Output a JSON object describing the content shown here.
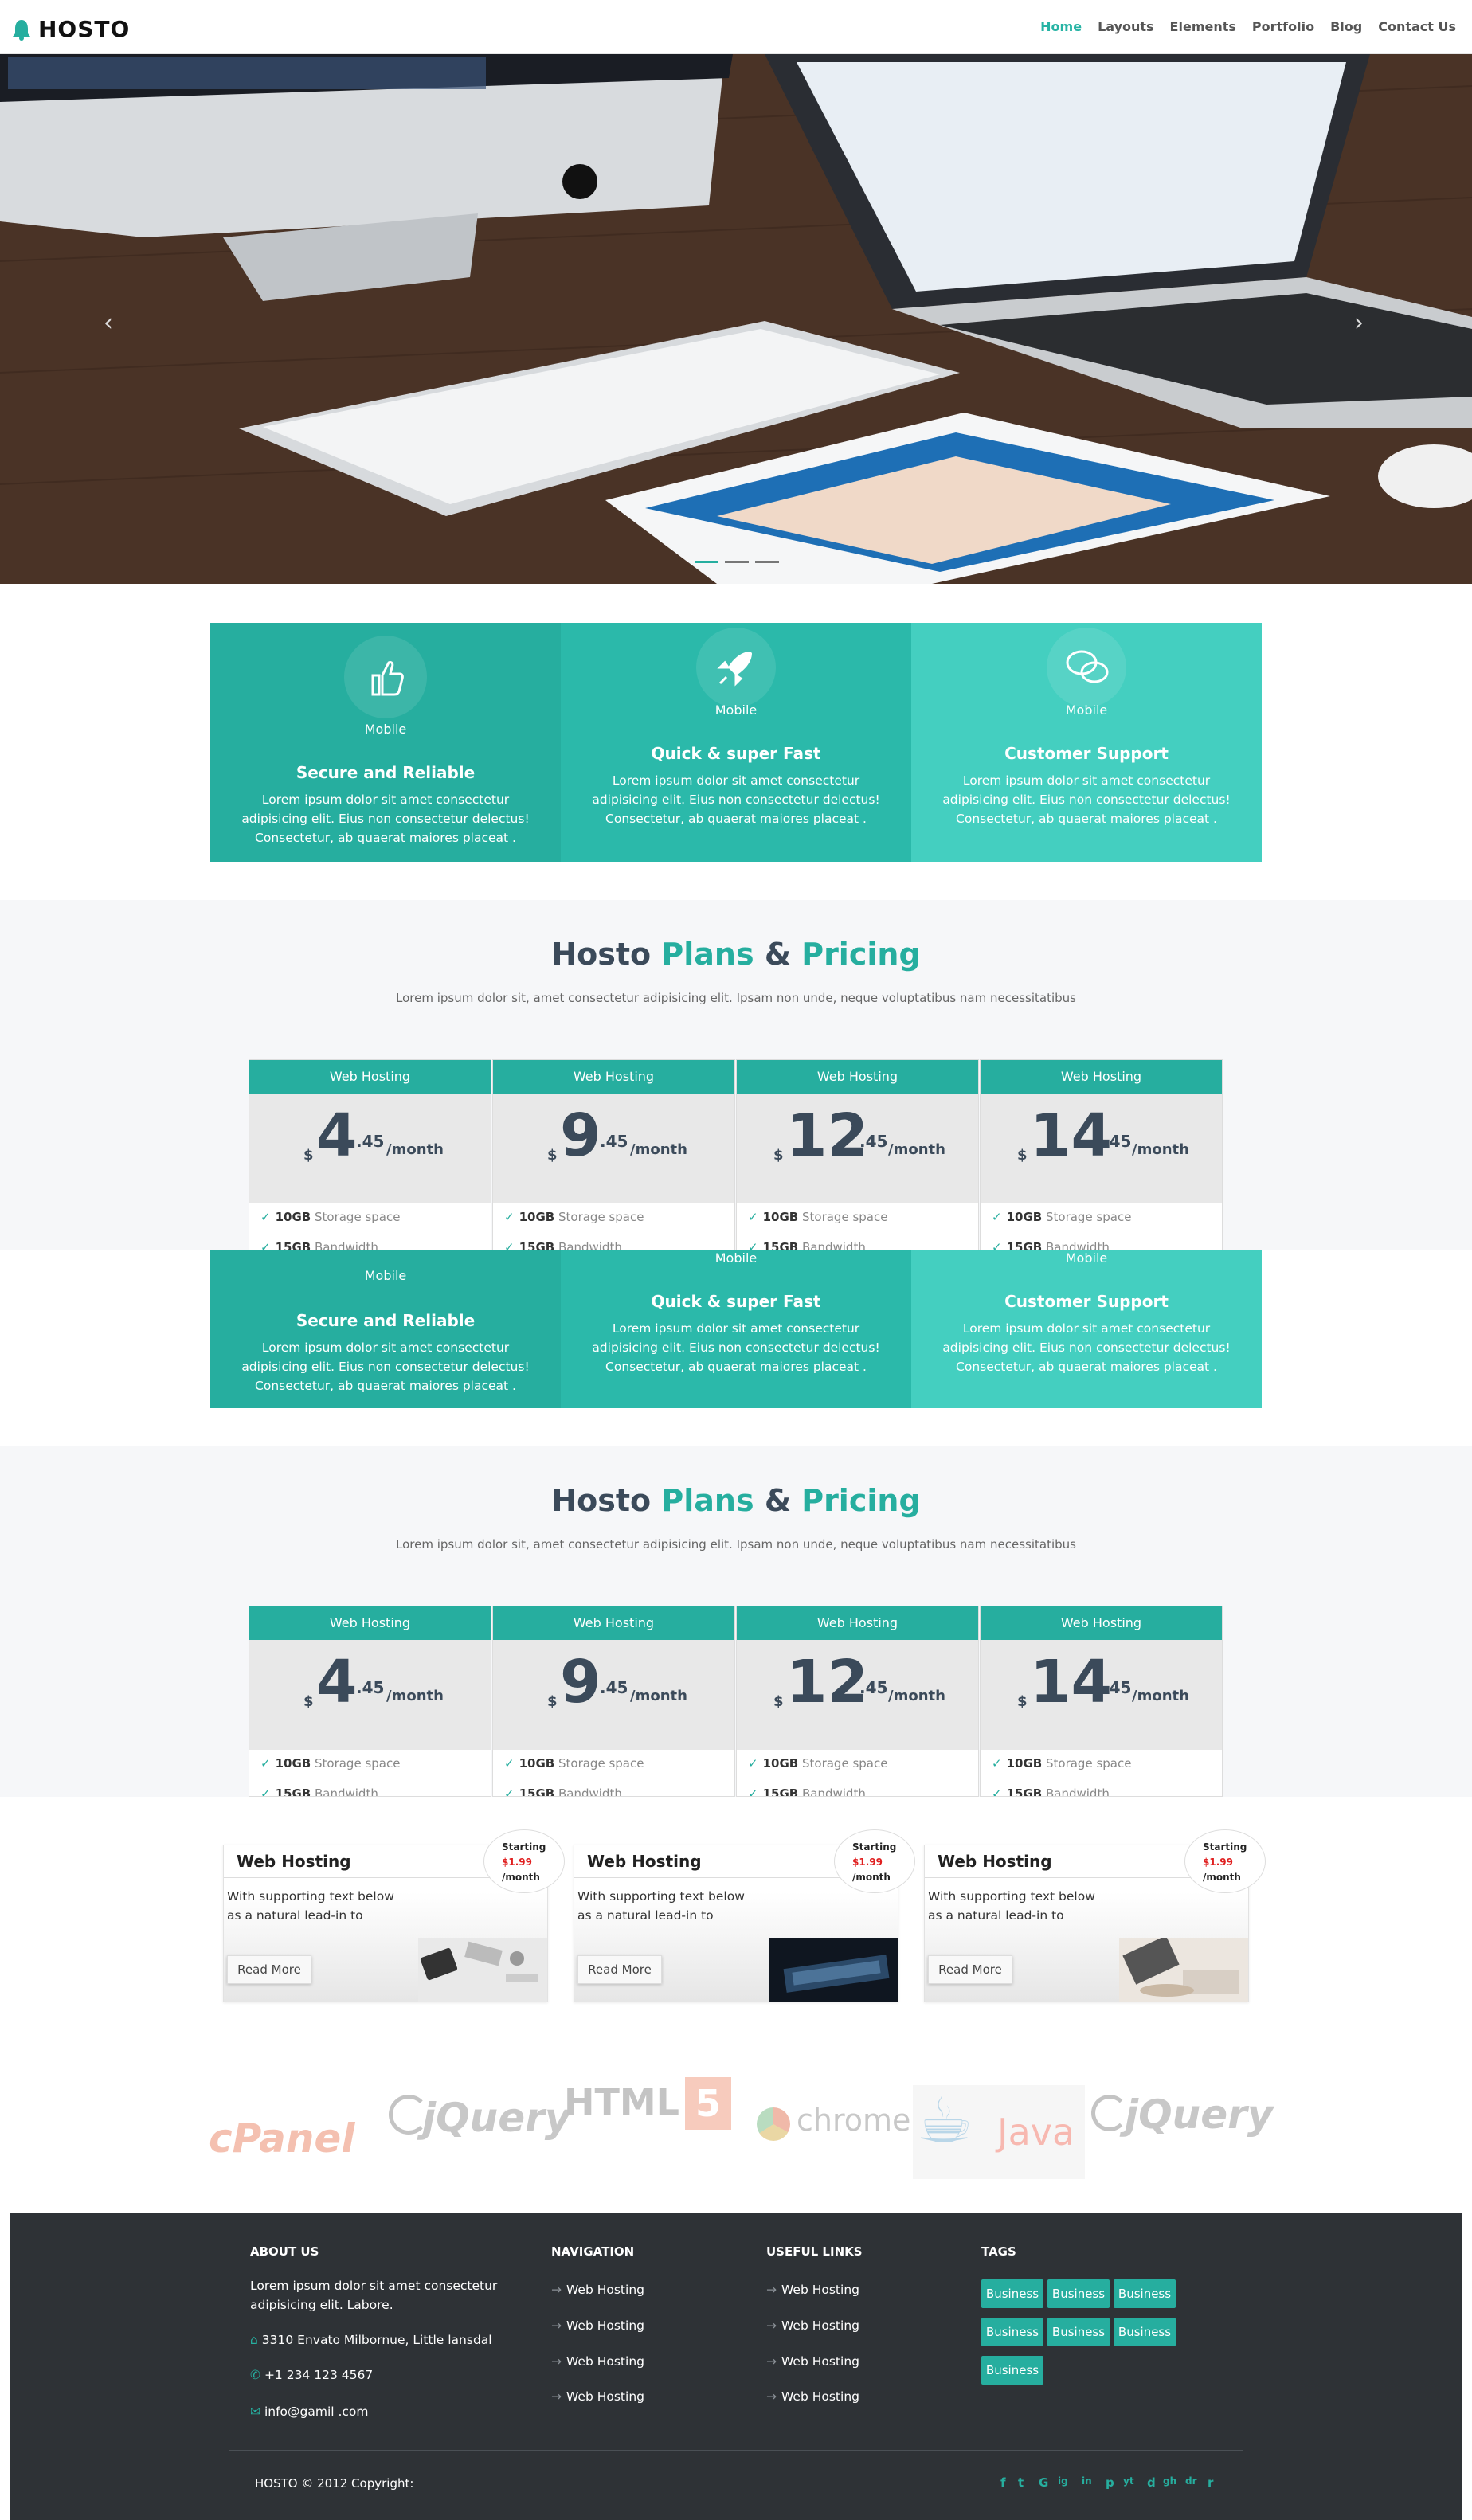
{
  "nav": {
    "brand": "HOSTO",
    "items": [
      "Home",
      "Layouts",
      "Elements",
      "Portfolio",
      "Blog",
      "Contact Us"
    ],
    "active": "Home"
  },
  "hero": {
    "prev_icon": "chevron-left-icon",
    "next_icon": "chevron-right-icon",
    "slides": 3,
    "active_slide": 1
  },
  "features": [
    {
      "icon": "thumbs-up-icon",
      "label": "Mobile",
      "title": "Secure and Reliable",
      "text": "Lorem ipsum dolor sit amet consectetur adipisicing elit. Eius non consectetur delectus! Consectetur, ab quaerat maiores placeat ."
    },
    {
      "icon": "rocket-icon",
      "label": "Mobile",
      "title": "Quick & super Fast",
      "text": "Lorem ipsum dolor sit amet consectetur adipisicing elit. Eius non consectetur delectus! Consectetur, ab quaerat maiores placeat ."
    },
    {
      "icon": "chat-bubbles-icon",
      "label": "Mobile",
      "title": "Customer Support",
      "text": "Lorem ipsum dolor sit amet consectetur adipisicing elit. Eius non consectetur delectus! Consectetur, ab quaerat maiores placeat ."
    }
  ],
  "pricing": {
    "title_parts": [
      "Hosto",
      "Plans",
      "&",
      "Pricing"
    ],
    "subtitle": "Lorem ipsum dolor sit, amet consectetur adipisicing elit. Ipsam non unde, neque voluptatibus nam necessitatibus",
    "currency": "$",
    "plans": [
      {
        "name": "Web Hosting",
        "whole": "4",
        "decimal": ".45",
        "period": "/month"
      },
      {
        "name": "Web Hosting",
        "whole": "9",
        "decimal": ".45",
        "period": "/month"
      },
      {
        "name": "Web Hosting",
        "whole": "12",
        "decimal": ".45",
        "period": "/month"
      },
      {
        "name": "Web Hosting",
        "whole": "14",
        "decimal": ".45",
        "period": "/month"
      }
    ],
    "features": [
      {
        "value": "10GB",
        "label": "Storage space"
      },
      {
        "value": "15GB",
        "label": "Bandwidth"
      }
    ]
  },
  "hosting_cards": [
    {
      "title": "Web Hosting",
      "text": "With supporting text below as a natural lead-in to",
      "button": "Read More",
      "badge_top": "Starting",
      "badge_price": "$1.99",
      "badge_period": "/month"
    },
    {
      "title": "Web Hosting",
      "text": "With supporting text below as a natural lead-in to",
      "button": "Read More",
      "badge_top": "Starting",
      "badge_price": "$1.99",
      "badge_period": "/month"
    },
    {
      "title": "Web Hosting",
      "text": "With supporting text below as a natural lead-in to",
      "button": "Read More",
      "badge_top": "Starting",
      "badge_price": "$1.99",
      "badge_period": "/month"
    }
  ],
  "brands": [
    "cPanel",
    "jQuery",
    "HTML",
    "chrome",
    "Java",
    "jQuery"
  ],
  "footer": {
    "about": {
      "heading": "ABOUT US",
      "text": "Lorem ipsum dolor sit amet consectetur adipisicing elit. Labore.",
      "address": "3310 Envato Milbornue, Little lansdal",
      "phone": "+1 234 123 4567",
      "email": "info@gamil .com"
    },
    "navigation": {
      "heading": "NAVIGATION",
      "links": [
        "Web Hosting",
        "Web Hosting",
        "Web Hosting",
        "Web Hosting"
      ]
    },
    "useful": {
      "heading": "USEFUL LINKS",
      "links": [
        "Web Hosting",
        "Web Hosting",
        "Web Hosting",
        "Web Hosting"
      ]
    },
    "tags": {
      "heading": "TAGS",
      "items": [
        "Business",
        "Business",
        "Business",
        "Business",
        "Business",
        "Business",
        "Business"
      ]
    },
    "copyright": "HOSTO © 2012 Copyright:",
    "social": [
      "f",
      "t",
      "G",
      "ig",
      "in",
      "p",
      "yt",
      "d",
      "gh",
      "dr",
      "r"
    ]
  },
  "colors": {
    "accent": "#26ae9f",
    "accent_light": "#44cfc0",
    "footer_bg": "#2e3236",
    "heading": "#3b4a5a"
  }
}
